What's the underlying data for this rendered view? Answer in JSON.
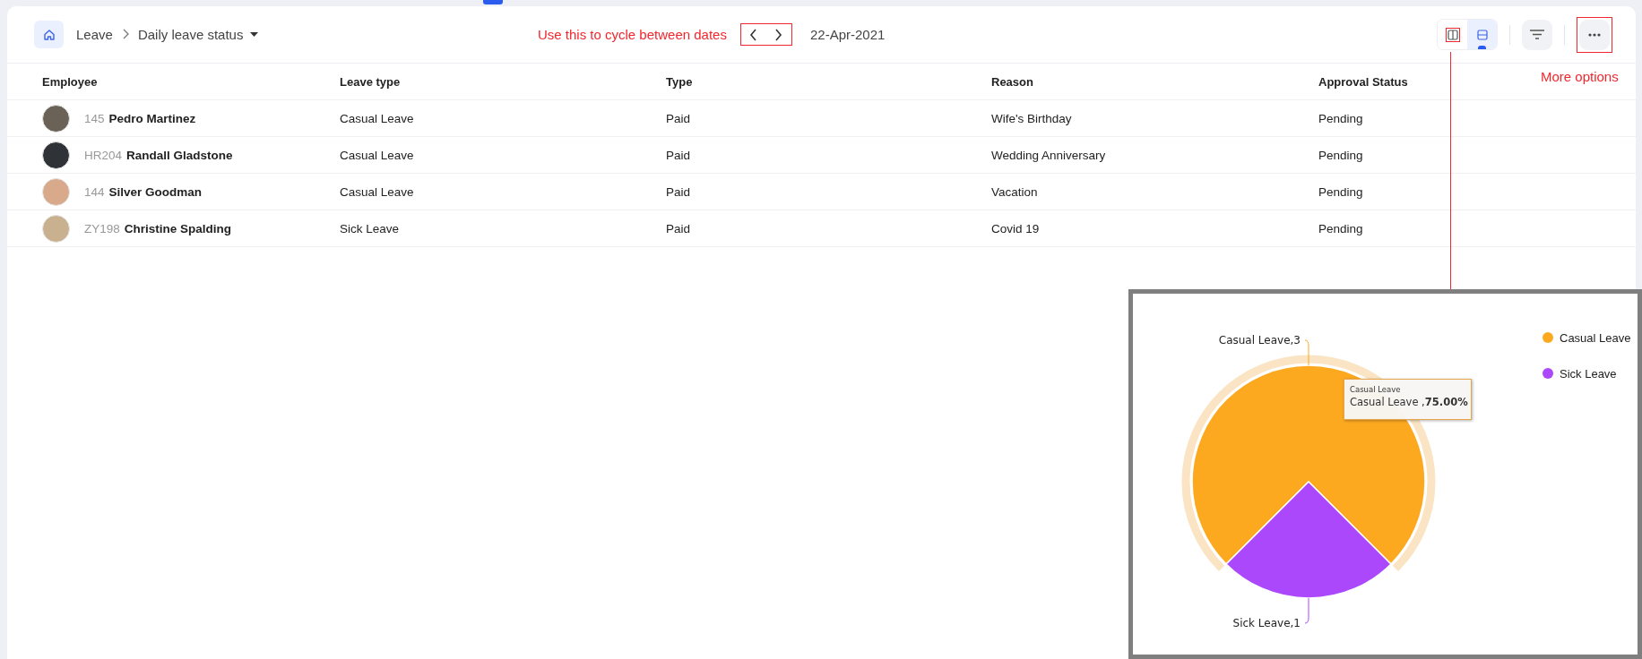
{
  "breadcrumb": {
    "items": [
      "Leave",
      "Daily leave status"
    ]
  },
  "annotations": [
    {
      "kind": "dates",
      "text": "Use this to cycle between dates"
    },
    {
      "kind": "more",
      "text": "More options"
    }
  ],
  "date_nav": {
    "date": "22-Apr-2021"
  },
  "view_toggle": [
    {
      "kind": "columns",
      "selected": false
    },
    {
      "kind": "rows",
      "selected": true
    }
  ],
  "table": {
    "columns": [
      "Employee",
      "Leave type",
      "Type",
      "Reason",
      "Approval Status"
    ],
    "rows": [
      {
        "id": "145",
        "name": "Pedro Martinez",
        "leave_type": "Casual Leave",
        "type": "Paid",
        "reason": "Wife's Birthday",
        "status": "Pending"
      },
      {
        "id": "HR204",
        "name": "Randall Gladstone",
        "leave_type": "Casual Leave",
        "type": "Paid",
        "reason": "Wedding Anniversary",
        "status": "Pending"
      },
      {
        "id": "144",
        "name": "Silver Goodman",
        "leave_type": "Casual Leave",
        "type": "Paid",
        "reason": "Vacation",
        "status": "Pending"
      },
      {
        "id": "ZY198",
        "name": "Christine Spalding",
        "leave_type": "Sick Leave",
        "type": "Paid",
        "reason": "Covid 19",
        "status": "Pending"
      }
    ]
  },
  "chart_panel": {
    "chart_data": {
      "type": "pie",
      "categories": [
        "Casual Leave",
        "Sick Leave"
      ],
      "values": [
        3,
        1
      ],
      "colors": [
        "#fda920",
        "#ab48fb"
      ],
      "legend": "right",
      "value_labels": [
        "Casual Leave,3",
        "Sick Leave,1"
      ]
    },
    "tooltip": {
      "title": "Casual Leave",
      "text": "Casual Leave ,**75.00%**"
    }
  }
}
